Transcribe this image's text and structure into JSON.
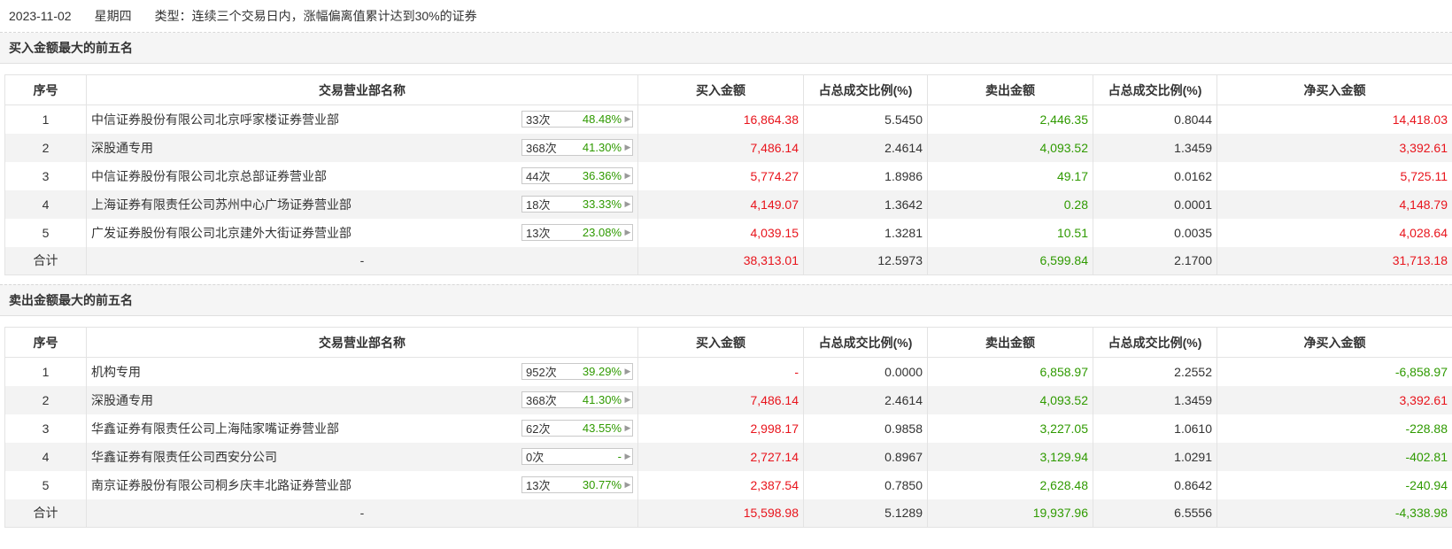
{
  "header": {
    "date": "2023-11-02",
    "weekday": "星期四",
    "type_text": "类型：连续三个交易日内，涨幅偏离值累计达到30%的证券"
  },
  "columns": [
    "序号",
    "交易营业部名称",
    "买入金额",
    "占总成交比例(%)",
    "卖出金额",
    "占总成交比例(%)",
    "净买入金额"
  ],
  "buy_section": {
    "title": "买入金额最大的前五名",
    "rows": [
      {
        "idx": "1",
        "name": "中信证券股份有限公司北京呼家楼证券营业部",
        "count": "33次",
        "rate": "48.48%",
        "buy": "16,864.38",
        "buy_pct": "5.5450",
        "sell": "2,446.35",
        "sell_pct": "0.8044",
        "net": "14,418.03",
        "net_sign": "pos"
      },
      {
        "idx": "2",
        "name": "深股通专用",
        "count": "368次",
        "rate": "41.30%",
        "buy": "7,486.14",
        "buy_pct": "2.4614",
        "sell": "4,093.52",
        "sell_pct": "1.3459",
        "net": "3,392.61",
        "net_sign": "pos"
      },
      {
        "idx": "3",
        "name": "中信证券股份有限公司北京总部证券营业部",
        "count": "44次",
        "rate": "36.36%",
        "buy": "5,774.27",
        "buy_pct": "1.8986",
        "sell": "49.17",
        "sell_pct": "0.0162",
        "net": "5,725.11",
        "net_sign": "pos"
      },
      {
        "idx": "4",
        "name": "上海证券有限责任公司苏州中心广场证券营业部",
        "count": "18次",
        "rate": "33.33%",
        "buy": "4,149.07",
        "buy_pct": "1.3642",
        "sell": "0.28",
        "sell_pct": "0.0001",
        "net": "4,148.79",
        "net_sign": "pos"
      },
      {
        "idx": "5",
        "name": "广发证券股份有限公司北京建外大街证券营业部",
        "count": "13次",
        "rate": "23.08%",
        "buy": "4,039.15",
        "buy_pct": "1.3281",
        "sell": "10.51",
        "sell_pct": "0.0035",
        "net": "4,028.64",
        "net_sign": "pos"
      }
    ],
    "total": {
      "label": "合计",
      "name": "-",
      "buy": "38,313.01",
      "buy_pct": "12.5973",
      "sell": "6,599.84",
      "sell_pct": "2.1700",
      "net": "31,713.18",
      "net_sign": "pos"
    }
  },
  "sell_section": {
    "title": "卖出金额最大的前五名",
    "rows": [
      {
        "idx": "1",
        "name": "机构专用",
        "count": "952次",
        "rate": "39.29%",
        "buy": "-",
        "buy_pct": "0.0000",
        "sell": "6,858.97",
        "sell_pct": "2.2552",
        "net": "-6,858.97",
        "net_sign": "neg"
      },
      {
        "idx": "2",
        "name": "深股通专用",
        "count": "368次",
        "rate": "41.30%",
        "buy": "7,486.14",
        "buy_pct": "2.4614",
        "sell": "4,093.52",
        "sell_pct": "1.3459",
        "net": "3,392.61",
        "net_sign": "pos"
      },
      {
        "idx": "3",
        "name": "华鑫证券有限责任公司上海陆家嘴证券营业部",
        "count": "62次",
        "rate": "43.55%",
        "buy": "2,998.17",
        "buy_pct": "0.9858",
        "sell": "3,227.05",
        "sell_pct": "1.0610",
        "net": "-228.88",
        "net_sign": "neg"
      },
      {
        "idx": "4",
        "name": "华鑫证券有限责任公司西安分公司",
        "count": "0次",
        "rate": "-",
        "buy": "2,727.14",
        "buy_pct": "0.8967",
        "sell": "3,129.94",
        "sell_pct": "1.0291",
        "net": "-402.81",
        "net_sign": "neg"
      },
      {
        "idx": "5",
        "name": "南京证券股份有限公司桐乡庆丰北路证券营业部",
        "count": "13次",
        "rate": "30.77%",
        "buy": "2,387.54",
        "buy_pct": "0.7850",
        "sell": "2,628.48",
        "sell_pct": "0.8642",
        "net": "-240.94",
        "net_sign": "neg"
      }
    ],
    "total": {
      "label": "合计",
      "name": "-",
      "buy": "15,598.98",
      "buy_pct": "5.1289",
      "sell": "19,937.96",
      "sell_pct": "6.5556",
      "net": "-4,338.98",
      "net_sign": "neg"
    }
  },
  "colors": {
    "red": "#e8141c",
    "green": "#2f9a00",
    "stripe": "#f3f3f3"
  }
}
